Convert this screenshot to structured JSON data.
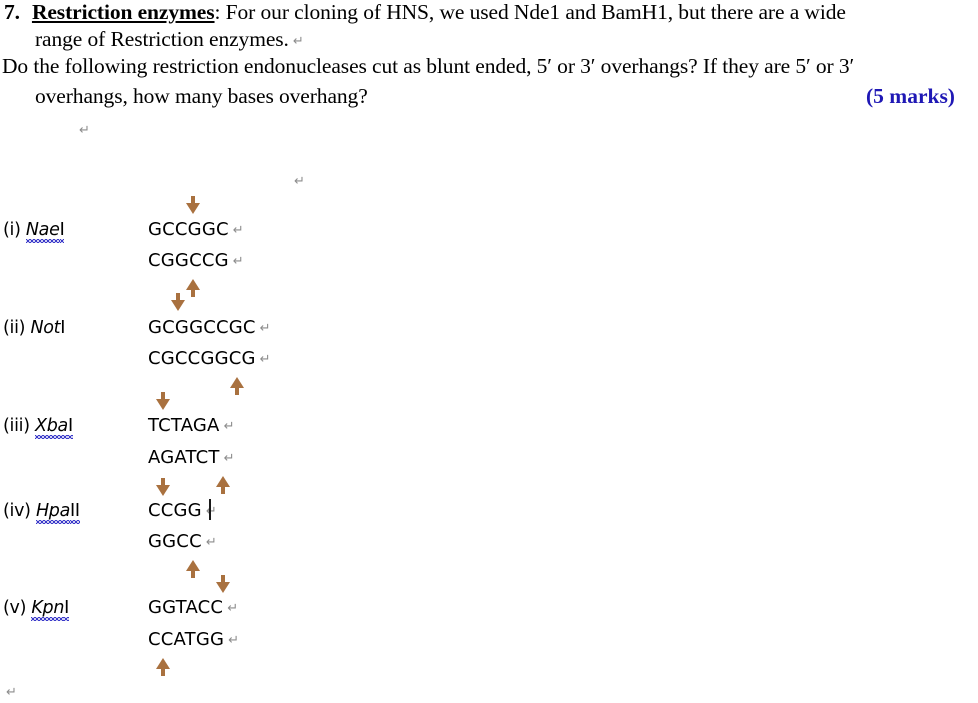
{
  "question": {
    "number": "7.",
    "title": "Restriction enzymes",
    "line1_rest": ": For our cloning of HNS, we used Nde1 and BamH1, but there are a wide",
    "line2": "range of Restriction enzymes.",
    "line3": "Do the following restriction endonucleases cut as blunt ended, 5′ or 3′ overhangs?  If they are 5′ or 3′",
    "line4": "overhangs, how many bases overhang?",
    "marks": "(5 marks)",
    "marks_color": "#1f18b5"
  },
  "marks_symbols": {
    "return": "↵"
  },
  "arrow_color": "#a9713f",
  "enzymes": [
    {
      "index": "(i)",
      "name": "Nae",
      "suffix": "I",
      "misspelled": true,
      "top_strand": "GCCGGC",
      "bottom_strand": "CGGCCG",
      "top_cut_after": 3,
      "bottom_cut_after": 3
    },
    {
      "index": "(ii)",
      "name": "Not",
      "suffix": "I",
      "misspelled": false,
      "top_strand": "GCGGCCGC",
      "bottom_strand": "CGCCGGCG",
      "top_cut_after": 2,
      "bottom_cut_after": 6
    },
    {
      "index": "(iii)",
      "name": "Xba",
      "suffix": "I",
      "misspelled": true,
      "top_strand": "TCTAGA",
      "bottom_strand": "AGATCT",
      "top_cut_after": 1,
      "bottom_cut_after": 5
    },
    {
      "index": "(iv)",
      "name": "Hpa",
      "suffix": "II",
      "misspelled": true,
      "top_strand": "CCGG",
      "bottom_strand": "GGCC",
      "top_cut_after": 1,
      "bottom_cut_after": 3
    },
    {
      "index": "(v)",
      "name": "Kpn",
      "suffix": "I",
      "misspelled": true,
      "top_strand": "GGTACC",
      "bottom_strand": "CCATGG",
      "top_cut_after": 5,
      "bottom_cut_after": 1
    }
  ]
}
